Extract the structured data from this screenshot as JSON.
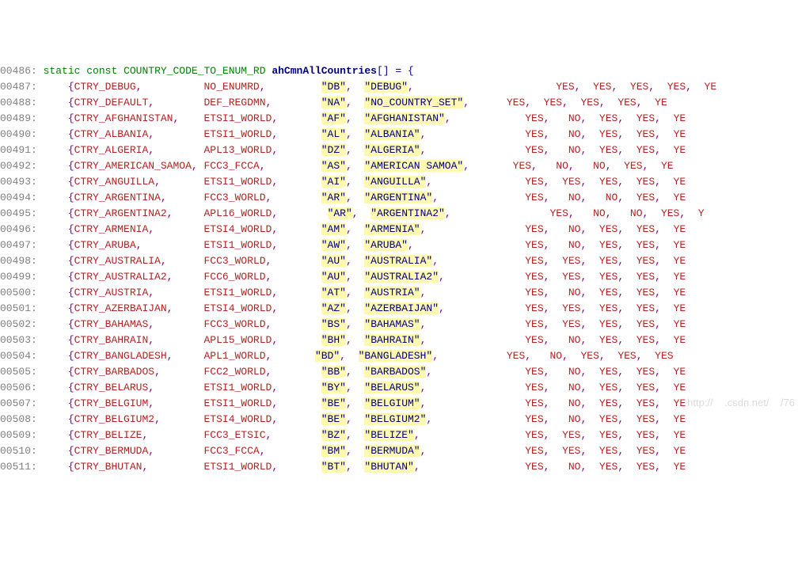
{
  "header": {
    "linenum": "00486:",
    "kw1": "static",
    "kw2": "const",
    "type": "COUNTRY_CODE_TO_ENUM_RD",
    "var": "ahCmnAllCountries",
    "brackets": "[]",
    "eq": " = ",
    "brace": "{"
  },
  "rows": [
    {
      "ln": "00487:",
      "c1": "CTRY_DEBUG",
      "c2": "NO_ENUMRD",
      "s1": "\"DB\"",
      "s2": "\"DEBUG\"",
      "flags": [
        "YES",
        "YES",
        "YES",
        "YES",
        "YE"
      ],
      "pad1": 9,
      "pad2": 5,
      "pad3": 3,
      "pad4": 8,
      "fpad": [
        15,
        2,
        2,
        2,
        2
      ]
    },
    {
      "ln": "00488:",
      "c1": "CTRY_DEFAULT",
      "c2": "DEF_REGDMN",
      "s1": "\"NA\"",
      "s2": "\"NO_COUNTRY_SET\"",
      "flags": [
        "YES",
        "YES",
        "YES",
        "YES",
        "YE"
      ],
      "pad1": 7,
      "pad2": 4,
      "pad3": 3,
      "pad4": -1,
      "fpad": [
        6,
        2,
        2,
        2,
        2
      ]
    },
    {
      "ln": "00489:",
      "c1": "CTRY_AFGHANISTAN",
      "c2": "ETSI1_WORLD",
      "s1": "\"AF\"",
      "s2": "\"AFGHANISTAN\"",
      "flags": [
        "YES",
        "NO",
        "YES",
        "YES",
        "YE"
      ],
      "pad1": 3,
      "pad2": 3,
      "pad3": 3,
      "pad4": 2,
      "fpad": [
        10,
        3,
        2,
        2,
        2
      ]
    },
    {
      "ln": "00490:",
      "c1": "CTRY_ALBANIA",
      "c2": "ETSI1_WORLD",
      "s1": "\"AL\"",
      "s2": "\"ALBANIA\"",
      "flags": [
        "YES",
        "NO",
        "YES",
        "YES",
        "YE"
      ],
      "pad1": 7,
      "pad2": 3,
      "pad3": 3,
      "pad4": 6,
      "fpad": [
        10,
        3,
        2,
        2,
        2
      ]
    },
    {
      "ln": "00491:",
      "c1": "CTRY_ALGERIA",
      "c2": "APL13_WORLD",
      "s1": "\"DZ\"",
      "s2": "\"ALGERIA\"",
      "flags": [
        "YES",
        "NO",
        "YES",
        "YES",
        "YE"
      ],
      "pad1": 7,
      "pad2": 3,
      "pad3": 3,
      "pad4": 6,
      "fpad": [
        10,
        3,
        2,
        2,
        2
      ]
    },
    {
      "ln": "00492:",
      "c1": "CTRY_AMERICAN_SAMOA",
      "c2": "FCC3_FCCA",
      "s1": "\"AS\"",
      "s2": "\"AMERICAN SAMOA\"",
      "flags": [
        "YES",
        "NO",
        "NO",
        "YES",
        "YE"
      ],
      "pad1": 0,
      "pad2": 5,
      "pad3": 3,
      "pad4": -1,
      "fpad": [
        7,
        3,
        3,
        2,
        2
      ]
    },
    {
      "ln": "00493:",
      "c1": "CTRY_ANGUILLA",
      "c2": "ETSI1_WORLD",
      "s1": "\"AI\"",
      "s2": "\"ANGUILLA\"",
      "flags": [
        "YES",
        "YES",
        "YES",
        "YES",
        "YE"
      ],
      "pad1": 6,
      "pad2": 3,
      "pad3": 3,
      "pad4": 5,
      "fpad": [
        10,
        2,
        2,
        2,
        2
      ]
    },
    {
      "ln": "00494:",
      "c1": "CTRY_ARGENTINA",
      "c2": "FCC3_WORLD",
      "s1": "\"AR\"",
      "s2": "\"ARGENTINA\"",
      "flags": [
        "YES",
        "NO",
        "NO",
        "YES",
        "YE"
      ],
      "pad1": 5,
      "pad2": 4,
      "pad3": 3,
      "pad4": 4,
      "fpad": [
        10,
        3,
        3,
        2,
        2
      ]
    },
    {
      "ln": "00495:",
      "c1": "CTRY_ARGENTINA2",
      "c2": "APL16_WORLD",
      "s1": "\"AR\"",
      "s2": "\"ARGENTINA2\"",
      "flags": [
        "YES",
        "NO",
        "NO",
        "YES",
        "Y"
      ],
      "pad1": 4,
      "pad2": 3,
      "pad3": 4,
      "pad4": 3,
      "fpad": [
        13,
        3,
        3,
        2,
        2
      ]
    },
    {
      "ln": "00496:",
      "c1": "CTRY_ARMENIA",
      "c2": "ETSI4_WORLD",
      "s1": "\"AM\"",
      "s2": "\"ARMENIA\"",
      "flags": [
        "YES",
        "NO",
        "YES",
        "YES",
        "YE"
      ],
      "pad1": 7,
      "pad2": 3,
      "pad3": 3,
      "pad4": 6,
      "fpad": [
        10,
        3,
        2,
        2,
        2
      ]
    },
    {
      "ln": "00497:",
      "c1": "CTRY_ARUBA",
      "c2": "ETSI1_WORLD",
      "s1": "\"AW\"",
      "s2": "\"ARUBA\"",
      "flags": [
        "YES",
        "NO",
        "YES",
        "YES",
        "YE"
      ],
      "pad1": 9,
      "pad2": 3,
      "pad3": 3,
      "pad4": 8,
      "fpad": [
        10,
        3,
        2,
        2,
        2
      ]
    },
    {
      "ln": "00498:",
      "c1": "CTRY_AUSTRALIA",
      "c2": "FCC3_WORLD",
      "s1": "\"AU\"",
      "s2": "\"AUSTRALIA\"",
      "flags": [
        "YES",
        "YES",
        "YES",
        "YES",
        "YE"
      ],
      "pad1": 5,
      "pad2": 4,
      "pad3": 3,
      "pad4": 4,
      "fpad": [
        10,
        2,
        2,
        2,
        2
      ]
    },
    {
      "ln": "00499:",
      "c1": "CTRY_AUSTRALIA2",
      "c2": "FCC6_WORLD",
      "s1": "\"AU\"",
      "s2": "\"AUSTRALIA2\"",
      "flags": [
        "YES",
        "YES",
        "YES",
        "YES",
        "YE"
      ],
      "pad1": 4,
      "pad2": 4,
      "pad3": 3,
      "pad4": 3,
      "fpad": [
        10,
        2,
        2,
        2,
        2
      ]
    },
    {
      "ln": "00500:",
      "c1": "CTRY_AUSTRIA",
      "c2": "ETSI1_WORLD",
      "s1": "\"AT\"",
      "s2": "\"AUSTRIA\"",
      "flags": [
        "YES",
        "NO",
        "YES",
        "YES",
        "YE"
      ],
      "pad1": 7,
      "pad2": 3,
      "pad3": 3,
      "pad4": 6,
      "fpad": [
        10,
        3,
        2,
        2,
        2
      ]
    },
    {
      "ln": "00501:",
      "c1": "CTRY_AZERBAIJAN",
      "c2": "ETSI4_WORLD",
      "s1": "\"AZ\"",
      "s2": "\"AZERBAIJAN\"",
      "flags": [
        "YES",
        "YES",
        "YES",
        "YES",
        "YE"
      ],
      "pad1": 4,
      "pad2": 3,
      "pad3": 3,
      "pad4": 3,
      "fpad": [
        10,
        2,
        2,
        2,
        2
      ]
    },
    {
      "ln": "00502:",
      "c1": "CTRY_BAHAMAS",
      "c2": "FCC3_WORLD",
      "s1": "\"BS\"",
      "s2": "\"BAHAMAS\"",
      "flags": [
        "YES",
        "YES",
        "YES",
        "YES",
        "YE"
      ],
      "pad1": 7,
      "pad2": 4,
      "pad3": 3,
      "pad4": 6,
      "fpad": [
        10,
        2,
        2,
        2,
        2
      ]
    },
    {
      "ln": "00503:",
      "c1": "CTRY_BAHRAIN",
      "c2": "APL15_WORLD",
      "s1": "\"BH\"",
      "s2": "\"BAHRAIN\"",
      "flags": [
        "YES",
        "NO",
        "YES",
        "YES",
        "YE"
      ],
      "pad1": 7,
      "pad2": 3,
      "pad3": 3,
      "pad4": 6,
      "fpad": [
        10,
        3,
        2,
        2,
        2
      ]
    },
    {
      "ln": "00504:",
      "c1": "CTRY_BANGLADESH",
      "c2": "APL1_WORLD",
      "s1": "\"BD\"",
      "s2": "\"BANGLADESH\"",
      "flags": [
        "YES",
        "NO",
        "YES",
        "YES",
        "YES"
      ],
      "pad1": 4,
      "pad2": 4,
      "pad3": 2,
      "pad4": 2,
      "fpad": [
        9,
        3,
        2,
        2,
        2
      ]
    },
    {
      "ln": "00505:",
      "c1": "CTRY_BARBADOS",
      "c2": "FCC2_WORLD",
      "s1": "\"BB\"",
      "s2": "\"BARBADOS\"",
      "flags": [
        "YES",
        "NO",
        "YES",
        "YES",
        "YE"
      ],
      "pad1": 6,
      "pad2": 4,
      "pad3": 3,
      "pad4": 5,
      "fpad": [
        10,
        3,
        2,
        2,
        2
      ]
    },
    {
      "ln": "00506:",
      "c1": "CTRY_BELARUS",
      "c2": "ETSI1_WORLD",
      "s1": "\"BY\"",
      "s2": "\"BELARUS\"",
      "flags": [
        "YES",
        "NO",
        "YES",
        "YES",
        "YE"
      ],
      "pad1": 7,
      "pad2": 3,
      "pad3": 3,
      "pad4": 6,
      "fpad": [
        10,
        3,
        2,
        2,
        2
      ]
    },
    {
      "ln": "00507:",
      "c1": "CTRY_BELGIUM",
      "c2": "ETSI1_WORLD",
      "s1": "\"BE\"",
      "s2": "\"BELGIUM\"",
      "flags": [
        "YES",
        "NO",
        "YES",
        "YES",
        "YE"
      ],
      "pad1": 7,
      "pad2": 3,
      "pad3": 3,
      "pad4": 6,
      "fpad": [
        10,
        3,
        2,
        2,
        2
      ]
    },
    {
      "ln": "00508:",
      "c1": "CTRY_BELGIUM2",
      "c2": "ETSI4_WORLD",
      "s1": "\"BE\"",
      "s2": "\"BELGIUM2\"",
      "flags": [
        "YES",
        "NO",
        "YES",
        "YES",
        "YE"
      ],
      "pad1": 6,
      "pad2": 3,
      "pad3": 3,
      "pad4": 5,
      "fpad": [
        10,
        3,
        2,
        2,
        2
      ]
    },
    {
      "ln": "00509:",
      "c1": "CTRY_BELIZE",
      "c2": "FCC3_ETSIC",
      "s1": "\"BZ\"",
      "s2": "\"BELIZE\"",
      "flags": [
        "YES",
        "YES",
        "YES",
        "YES",
        "YE"
      ],
      "pad1": 8,
      "pad2": 4,
      "pad3": 3,
      "pad4": 7,
      "fpad": [
        10,
        2,
        2,
        2,
        2
      ]
    },
    {
      "ln": "00510:",
      "c1": "CTRY_BERMUDA",
      "c2": "FCC3_FCCA",
      "s1": "\"BM\"",
      "s2": "\"BERMUDA\"",
      "flags": [
        "YES",
        "YES",
        "YES",
        "YES",
        "YE"
      ],
      "pad1": 7,
      "pad2": 5,
      "pad3": 3,
      "pad4": 6,
      "fpad": [
        10,
        2,
        2,
        2,
        2
      ]
    },
    {
      "ln": "00511:",
      "c1": "CTRY_BHUTAN",
      "c2": "ETSI1_WORLD",
      "s1": "\"BT\"",
      "s2": "\"BHUTAN\"",
      "flags": [
        "YES",
        "NO",
        "YES",
        "YES",
        "YE"
      ],
      "pad1": 8,
      "pad2": 3,
      "pad3": 3,
      "pad4": 7,
      "fpad": [
        10,
        3,
        2,
        2,
        2
      ]
    }
  ],
  "watermark": "http://    .csdn.net/    /76"
}
